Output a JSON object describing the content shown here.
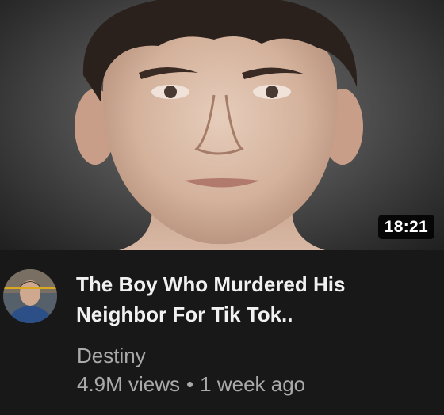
{
  "video": {
    "duration": "18:21",
    "title": "The Boy Who Murdered His Neighbor For Tik Tok..",
    "channel": "Destiny",
    "views": "4.9M views",
    "separator": "•",
    "age": "1 week ago"
  },
  "colors": {
    "background": "#181818",
    "title_text": "#f1f1f1",
    "secondary_text": "#aaaaaa",
    "duration_badge": "#000000"
  },
  "icons": {
    "thumbnail": "mugshot-photo",
    "avatar": "channel-avatar"
  }
}
